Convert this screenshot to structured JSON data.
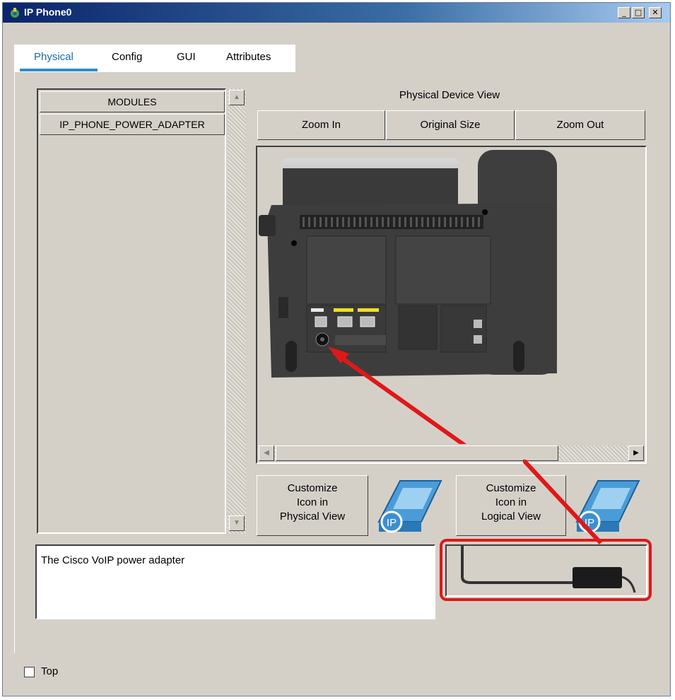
{
  "window": {
    "title": "IP Phone0",
    "controls": {
      "minimize": "_",
      "maximize": "□",
      "close": "✕"
    }
  },
  "tabs": [
    {
      "label": "Physical",
      "active": true
    },
    {
      "label": "Config",
      "active": false
    },
    {
      "label": "GUI",
      "active": false
    },
    {
      "label": "Attributes",
      "active": false
    }
  ],
  "modules": {
    "header": "MODULES",
    "items": [
      "IP_PHONE_POWER_ADAPTER"
    ]
  },
  "physical_view": {
    "title": "Physical Device View",
    "zoom_in": "Zoom In",
    "original_size": "Original Size",
    "zoom_out": "Zoom Out"
  },
  "customize": {
    "physical_line1": "Customize",
    "physical_line2": "Icon in",
    "physical_line3": "Physical View",
    "logical_line1": "Customize",
    "logical_line2": "Icon in",
    "logical_line3": "Logical View",
    "icon_badge": "IP"
  },
  "description": "The Cisco VoIP power adapter",
  "footer": {
    "top_label": "Top",
    "top_checked": false
  },
  "colors": {
    "highlight": "#e01818",
    "tab_active": "#1a6aa8",
    "titlebar": "#0a246a"
  }
}
